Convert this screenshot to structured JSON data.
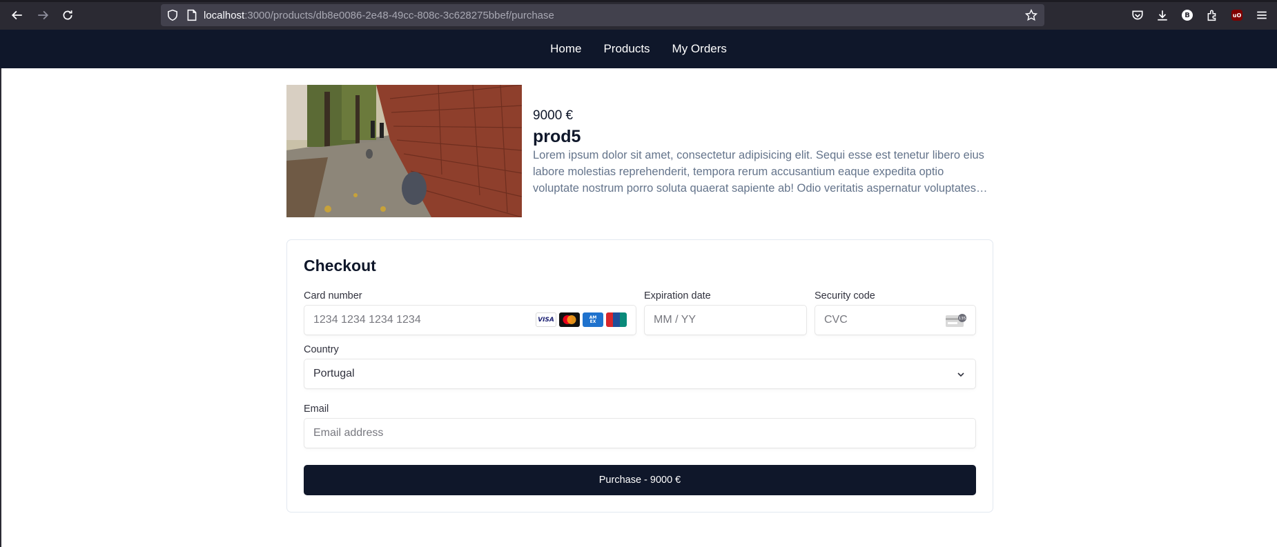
{
  "browser": {
    "url_host": "localhost",
    "url_rest": ":3000/products/db8e0086-2e48-49cc-808c-3c628275bbef/purchase",
    "icons": [
      "back-arrow-icon",
      "forward-arrow-icon",
      "reload-icon",
      "shield-icon",
      "page-icon",
      "star-icon",
      "pocket-icon",
      "download-icon",
      "profile-b-icon",
      "extensions-icon",
      "ublock-icon",
      "menu-icon"
    ],
    "profile_letter": "B",
    "ublock_letters": "uO"
  },
  "nav": {
    "items": [
      "Home",
      "Products",
      "My Orders"
    ],
    "background": "#0f172a"
  },
  "product": {
    "price": "9000 €",
    "name": "prod5",
    "description": "Lorem ipsum dolor sit amet, consectetur adipisicing elit. Sequi esse est tenetur libero eius labore molestias reprehenderit, tempora rerum accusantium eaque expedita optio voluptate nostrum porro soluta quaerat sapiente ab! Odio veritatis aspernatur voluptates quibusdam."
  },
  "checkout": {
    "title": "Checkout",
    "card_number": {
      "label": "Card number",
      "placeholder": "1234 1234 1234 1234",
      "brands": [
        "VISA",
        "Mastercard",
        "AMEX",
        "UnionPay"
      ]
    },
    "expiration": {
      "label": "Expiration date",
      "placeholder": "MM / YY"
    },
    "security": {
      "label": "Security code",
      "placeholder": "CVC",
      "hint": "135"
    },
    "country": {
      "label": "Country",
      "value": "Portugal"
    },
    "email": {
      "label": "Email",
      "placeholder": "Email address"
    },
    "purchase_label": "Purchase - 9000 €",
    "button_color": "#0f172a"
  }
}
